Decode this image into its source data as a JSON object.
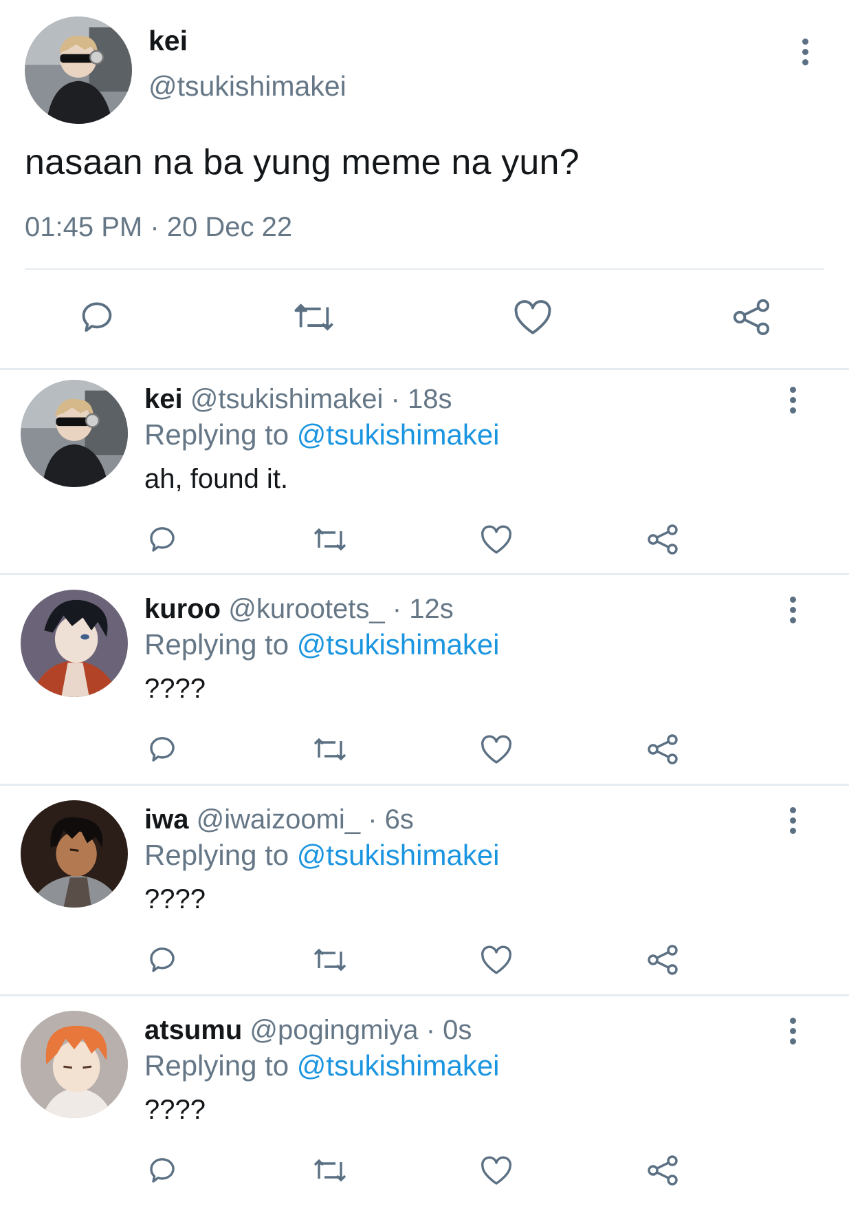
{
  "main_tweet": {
    "name": "kei",
    "handle": "@tsukishimakei",
    "text": "nasaan na ba yung meme na yun?",
    "timestamp": "01:45 PM · 20 Dec 22",
    "icons": [
      "reply-icon",
      "retweet-icon",
      "like-icon",
      "share-icon",
      "more-options-icon"
    ]
  },
  "replies": [
    {
      "name": "kei",
      "handle": "@tsukishimakei",
      "time": "· 18s",
      "replying_label": "Replying to",
      "replying_to": "@tsukishimakei",
      "text": "ah, found it."
    },
    {
      "name": "kuroo",
      "handle": "@kurootets_",
      "time": "· 12s",
      "replying_label": "Replying to",
      "replying_to": "@tsukishimakei",
      "text": "????"
    },
    {
      "name": "iwa",
      "handle": "@iwaizoomi_",
      "time": "· 6s",
      "replying_label": "Replying to",
      "replying_to": "@tsukishimakei",
      "text": "????"
    },
    {
      "name": "atsumu",
      "handle": "@pogingmiya",
      "time": "· 0s",
      "replying_label": "Replying to",
      "replying_to": "@tsukishimakei",
      "text": "????"
    }
  ],
  "colors": {
    "text": "#14171a",
    "secondary": "#657786",
    "mention": "#1b95e0",
    "icon": "#5b7083",
    "divider": "#e6ecf0"
  }
}
